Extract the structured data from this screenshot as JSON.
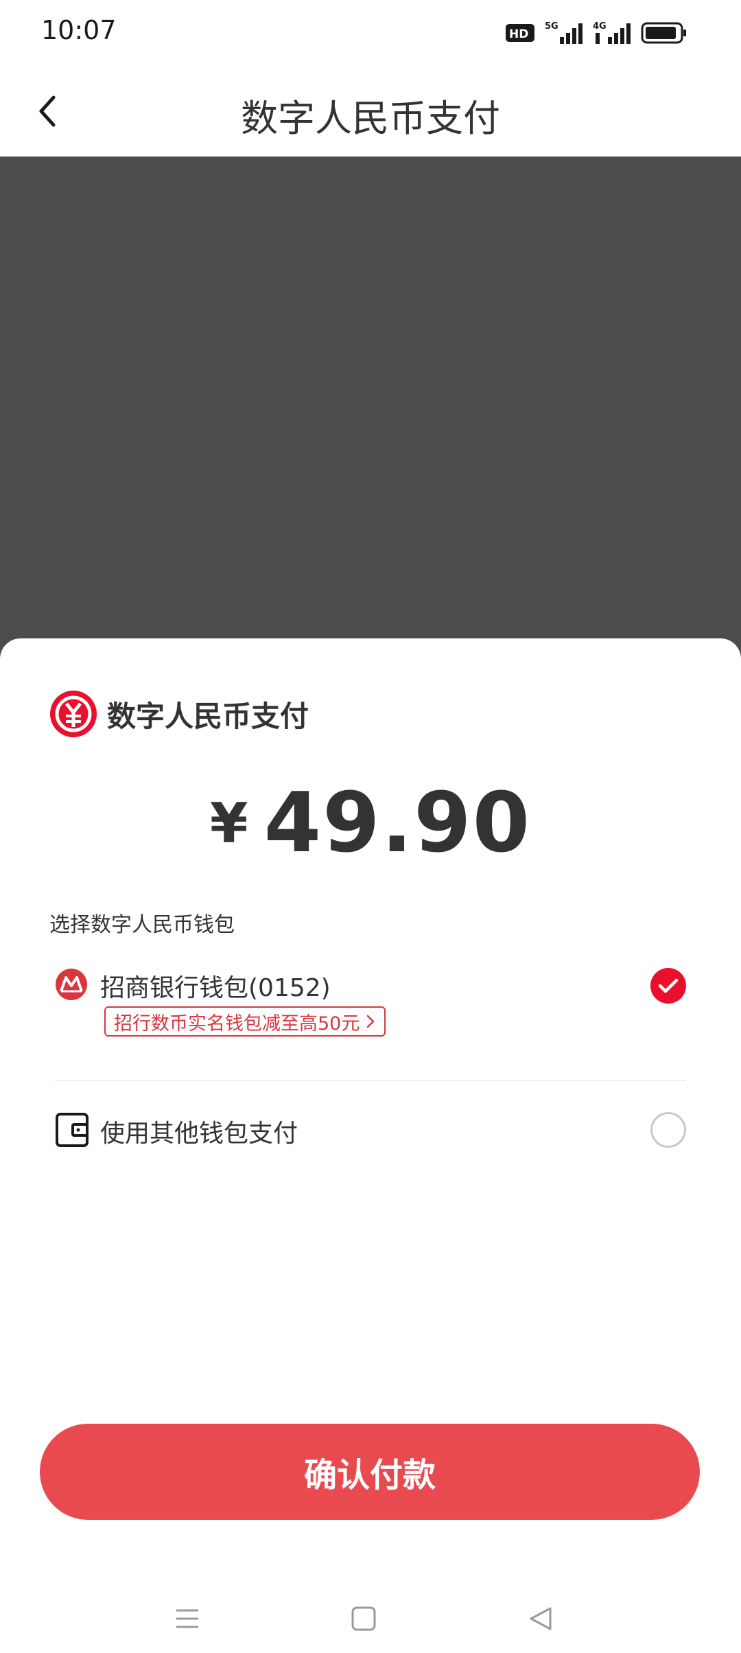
{
  "status_bar": {
    "time": "10:07",
    "hd_label": "HD",
    "network_5g": "5G",
    "network_4g": "4G"
  },
  "header": {
    "title": "数字人民币支付"
  },
  "sheet": {
    "brand_title": "数字人民币支付",
    "amount": {
      "currency": "¥",
      "value": "49.90"
    },
    "section_label": "选择数字人民币钱包",
    "wallets": [
      {
        "name": "招商银行钱包(0152)",
        "promo": "招行数币实名钱包减至高50元",
        "selected": true
      },
      {
        "name": "使用其他钱包支付",
        "selected": false
      }
    ],
    "confirm_label": "确认付款"
  },
  "colors": {
    "accent_red": "#e8102c",
    "button_red": "#e84a50",
    "overlay": "#4c4c4c"
  }
}
